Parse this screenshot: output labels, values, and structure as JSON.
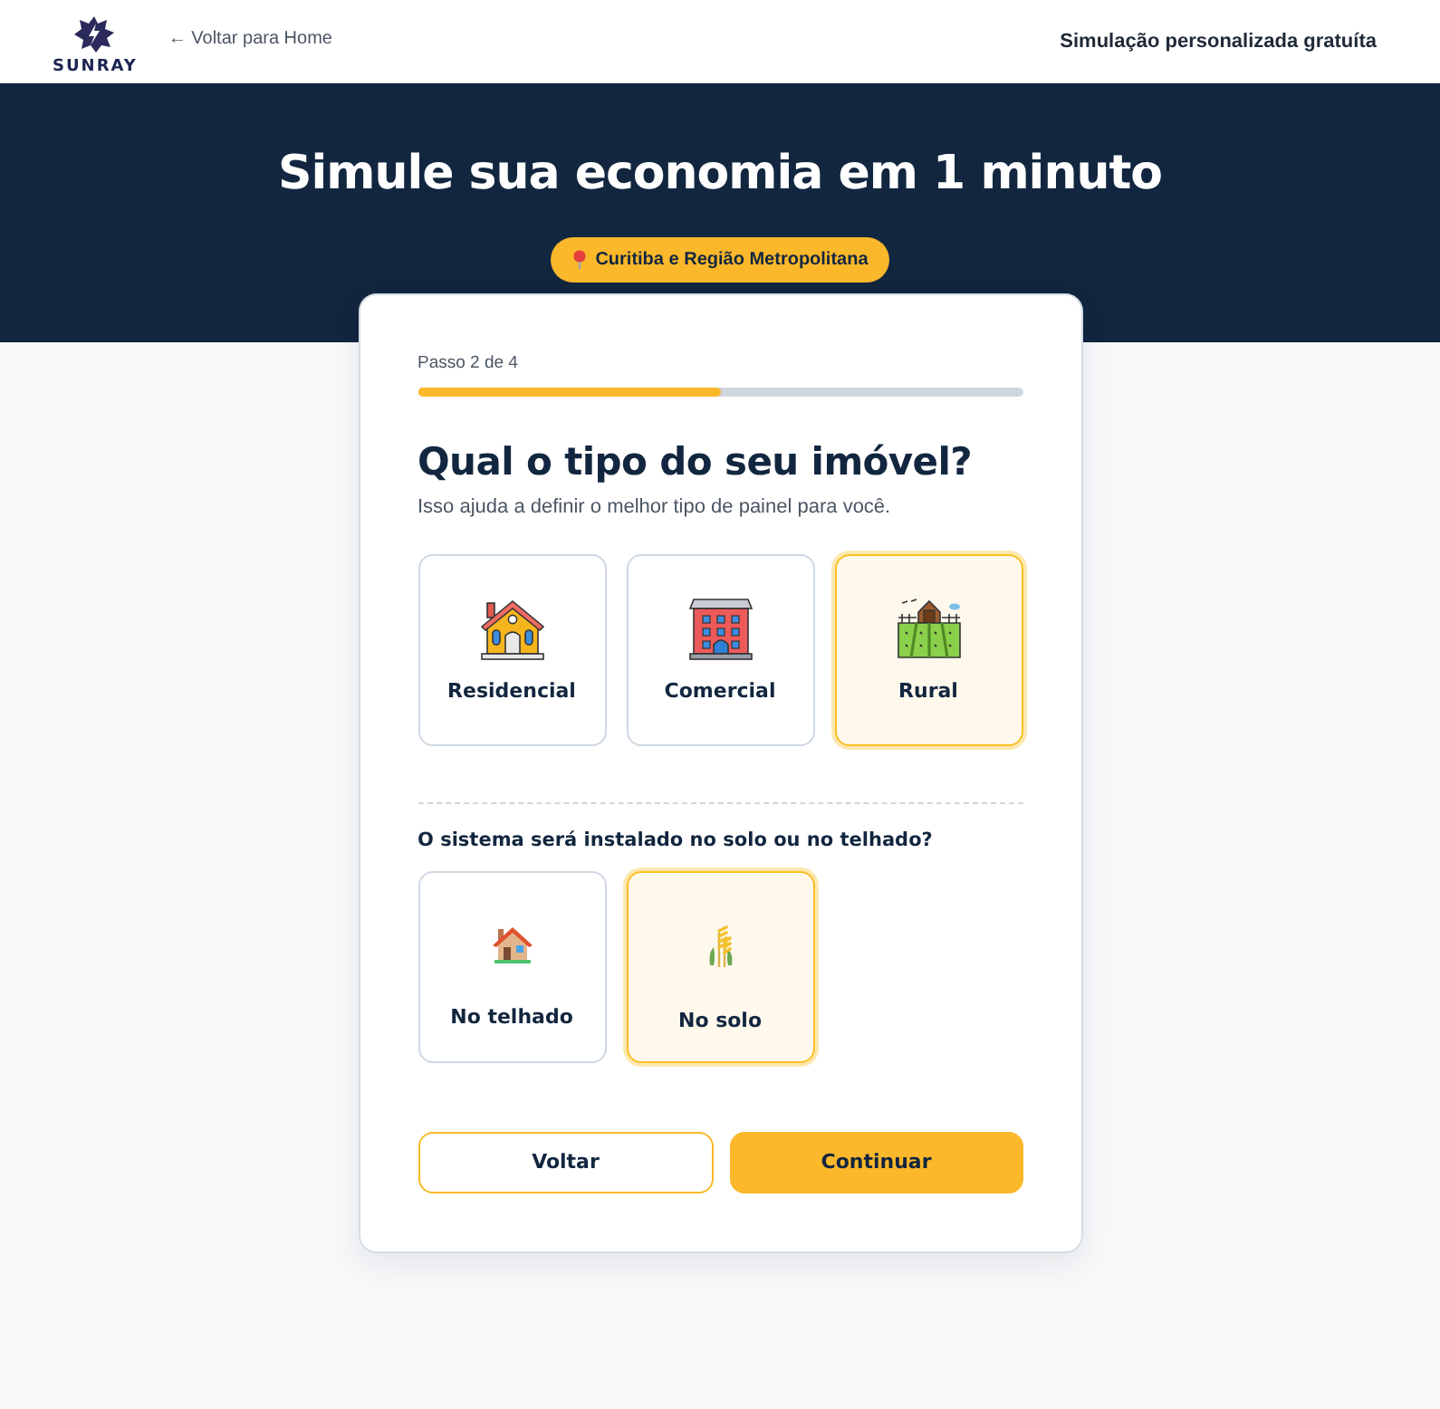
{
  "header": {
    "logo_text": "SUNRAY",
    "back_link": "← Voltar para Home",
    "tagline": "Simulação personalizada gratuíta"
  },
  "hero": {
    "title": "Simule sua economia em 1 minuto",
    "location_badge": "Curitiba e Região Metropolitana"
  },
  "form": {
    "step_label": "Passo 2 de 4",
    "progress": {
      "level": 0.5
    },
    "question": "Qual o tipo do seu imóvel?",
    "hint": "Isso ajuda a definir o melhor tipo de painel para você.",
    "property_types": [
      {
        "label": "Residencial",
        "kind": "house",
        "selected": false
      },
      {
        "label": "Comercial",
        "kind": "building",
        "selected": false
      },
      {
        "label": "Rural",
        "kind": "farm",
        "selected": true
      }
    ],
    "install_question": "O sistema será instalado no solo ou no telhado?",
    "install_options": [
      {
        "label": "No telhado",
        "kind": "roof",
        "selected": false
      },
      {
        "label": "No solo",
        "kind": "ground",
        "selected": true
      }
    ],
    "buttons": [
      {
        "label": "Voltar",
        "kind": "secondary"
      },
      {
        "label": "Continuar",
        "kind": "primary"
      }
    ]
  }
}
